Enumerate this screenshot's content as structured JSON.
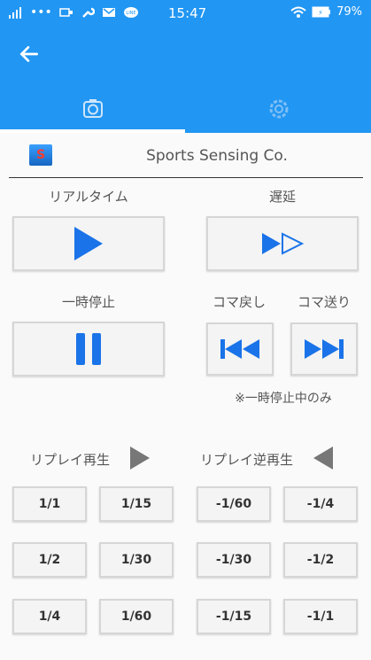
{
  "status": {
    "time": "15:47",
    "battery": "79%"
  },
  "header": {
    "company": "Sports Sensing Co."
  },
  "labels": {
    "realtime": "リアルタイム",
    "delay": "遅延",
    "pause": "一時停止",
    "frame_back": "コマ戻し",
    "frame_forward": "コマ送り",
    "pause_only": "※一時停止中のみ",
    "replay": "リプレイ再生",
    "replay_reverse": "リプレイ逆再生"
  },
  "replay_speeds": [
    "1/1",
    "1/15",
    "1/2",
    "1/30",
    "1/4",
    "1/60"
  ],
  "reverse_speeds": [
    "-1/60",
    "-1/4",
    "-1/30",
    "-1/2",
    "-1/15",
    "-1/1"
  ],
  "colors": {
    "accent": "#2196f3",
    "icon_blue": "#1a73e8"
  }
}
